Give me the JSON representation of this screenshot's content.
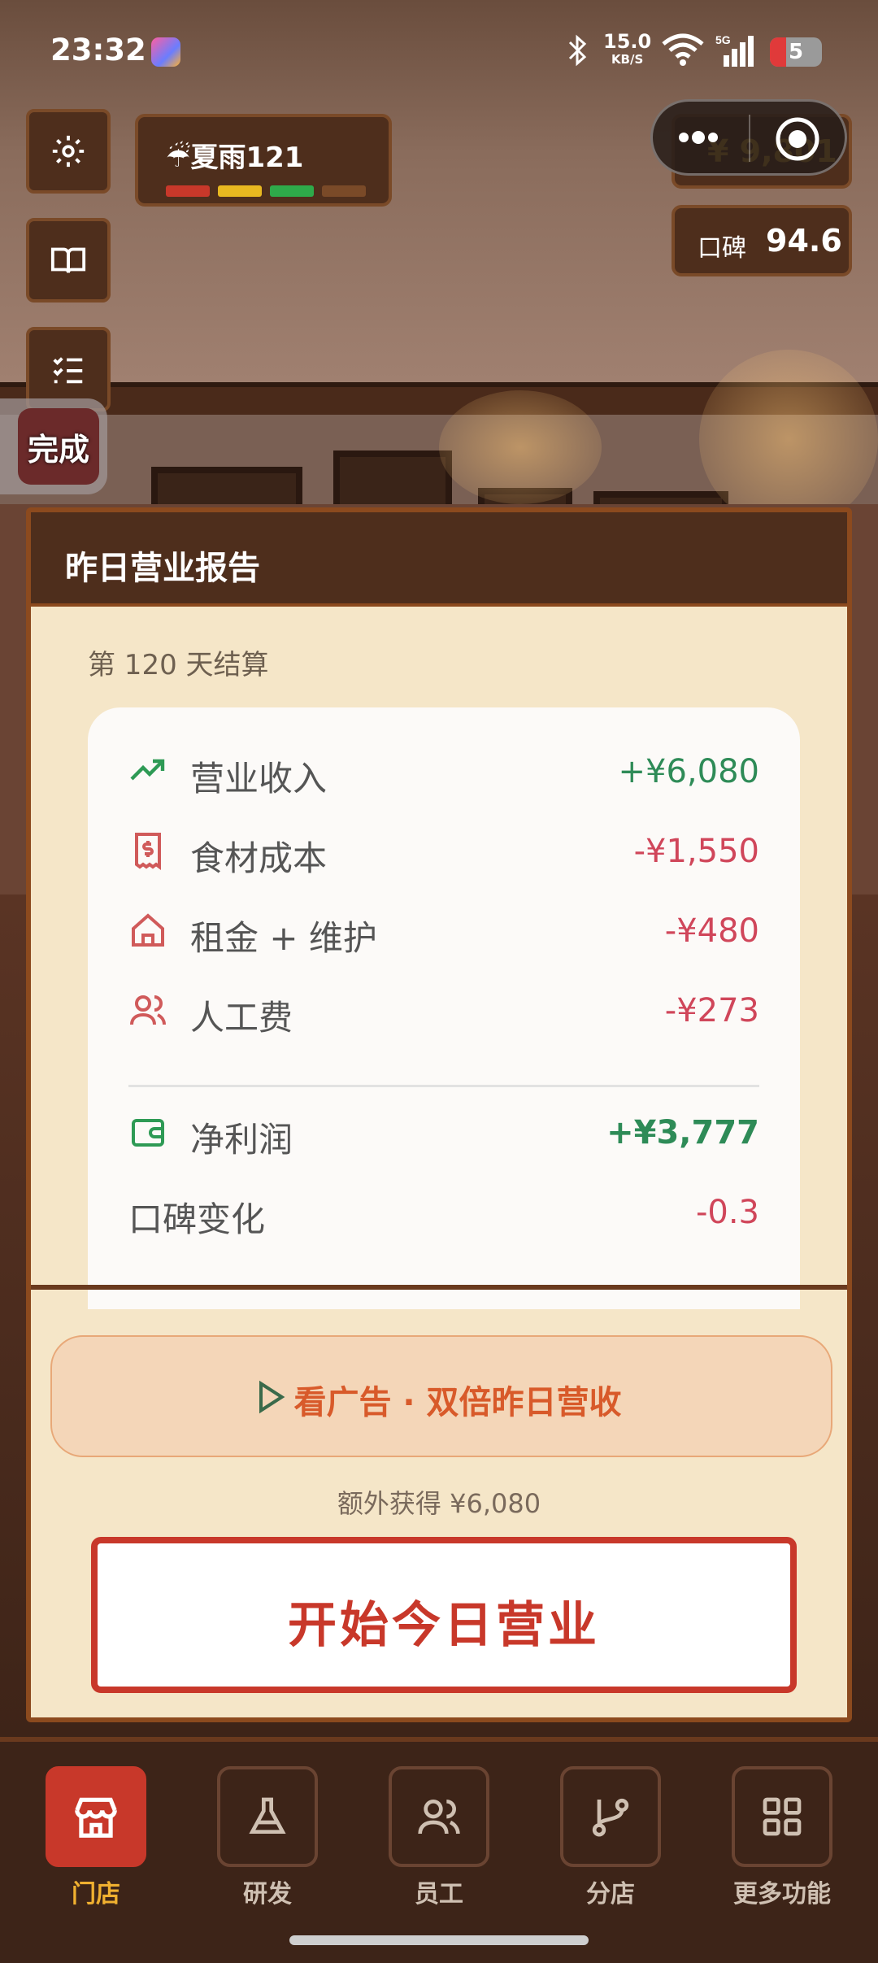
{
  "status_bar": {
    "time": "23:32",
    "network_speed": "15.0",
    "network_unit": "KB/S",
    "signal_type": "5G",
    "battery": "5"
  },
  "hud": {
    "weather_icon": "cloud-rain-icon",
    "weather_label": "☔夏雨121",
    "money": "¥ 9,801",
    "reputation_label": "口碑",
    "reputation_value": "94.6",
    "done_label": "完成"
  },
  "report": {
    "title": "昨日营业报告",
    "day_label": "第 120 天结算",
    "rows": [
      {
        "icon": "trending-up-icon",
        "label": "营业收入",
        "value": "+¥6,080"
      },
      {
        "icon": "receipt-icon",
        "label": "食材成本",
        "value": "-¥1,550"
      },
      {
        "icon": "home-icon",
        "label": "租金 + 维护",
        "value": "-¥480"
      },
      {
        "icon": "users-icon",
        "label": "人工费",
        "value": "-¥273"
      }
    ],
    "net_profit": {
      "icon": "wallet-icon",
      "label": "净利润",
      "value": "+¥3,777"
    },
    "reputation_change": {
      "label": "口碑变化",
      "value": "-0.3"
    },
    "ad_button": "看广告 · 双倍昨日营收",
    "extra_text": "额外获得 ¥6,080",
    "start_button": "开始今日营业"
  },
  "nav": {
    "items": [
      {
        "label": "门店",
        "icon": "store-icon",
        "active": true
      },
      {
        "label": "研发",
        "icon": "flask-icon",
        "active": false
      },
      {
        "label": "员工",
        "icon": "users-icon",
        "active": false
      },
      {
        "label": "分店",
        "icon": "branch-icon",
        "active": false
      },
      {
        "label": "更多功能",
        "icon": "grid-icon",
        "active": false
      }
    ]
  },
  "colors": {
    "positive": "#2e8b57",
    "negative": "#d0465a",
    "accent": "#c8382a",
    "nav_active_label": "#f0b030"
  }
}
